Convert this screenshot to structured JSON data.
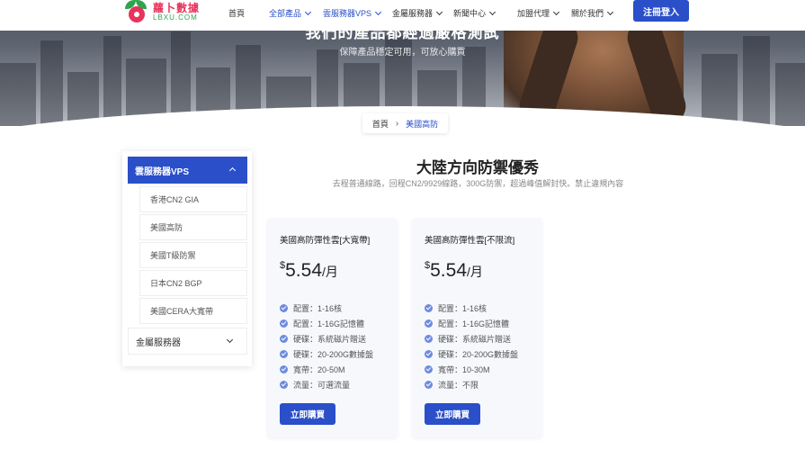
{
  "brand": {
    "name_cn": "蘿卜數據",
    "name_en": "LBXU.COM"
  },
  "nav": {
    "items": [
      {
        "label": "首頁"
      },
      {
        "label": "全部產品"
      },
      {
        "label": "雲服務器VPS"
      },
      {
        "label": "金屬服務器"
      },
      {
        "label": "新聞中心"
      },
      {
        "label": "加盟代理"
      },
      {
        "label": "關於我們"
      }
    ],
    "login_label": "注冊登入"
  },
  "hero": {
    "title": "我們的產品都經過嚴格測試",
    "subtitle": "保障產品穩定可用，可放心購買"
  },
  "breadcrumb": {
    "home": "首頁",
    "separator": "›",
    "current": "美國高防"
  },
  "sidebar": {
    "active_category": "雲服務器VPS",
    "sub_items": [
      "香港CN2 GIA",
      "美國高防",
      "美國T級防禦",
      "日本CN2 BGP",
      "美國CERA大寬帶"
    ],
    "other_category": "金屬服務器"
  },
  "main": {
    "title": "大陸方向防禦優秀",
    "description": "去程普通線路，回程CN2/9929線路，300G防禦，超過峰值解封快。禁止違規內容"
  },
  "cards": [
    {
      "title": "美國高防彈性雲[大寬帶]",
      "currency": "$",
      "price": "5.54",
      "unit": "/月",
      "features": [
        "配置：1-16核",
        "配置：1-16G記憶體",
        "硬碟：系統磁片贈送",
        "硬碟：20-200G數據盤",
        "寬帶：20-50M",
        "流量：可選流量"
      ],
      "button": "立即購買"
    },
    {
      "title": "美國高防彈性雲[不限流]",
      "currency": "$",
      "price": "5.54",
      "unit": "/月",
      "features": [
        "配置：1-16核",
        "配置：1-16G記憶體",
        "硬碟：系統磁片贈送",
        "硬碟：20-200G數據盤",
        "寬帶：10-30M",
        "流量：不限"
      ],
      "button": "立即購買"
    }
  ],
  "colors": {
    "primary": "#2a4fc9",
    "brand_red": "#e8335c",
    "brand_green": "#2ea44f"
  },
  "icons": [
    "chevron-down-icon",
    "chevron-up-icon",
    "check-circle-icon",
    "radish-logo-icon"
  ]
}
